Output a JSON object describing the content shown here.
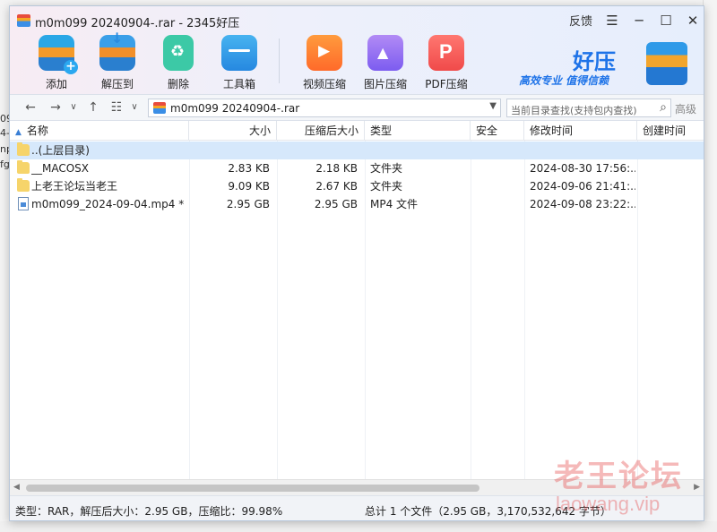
{
  "window": {
    "title": "m0m099 20240904-.rar - 2345好压",
    "feedback_label": "反馈"
  },
  "toolbar": [
    {
      "key": "add",
      "label": "添加",
      "icon": "add-archive-icon"
    },
    {
      "key": "extract",
      "label": "解压到",
      "icon": "extract-icon"
    },
    {
      "key": "delete",
      "label": "删除",
      "icon": "recycle-delete-icon"
    },
    {
      "key": "toolbox",
      "label": "工具箱",
      "icon": "toolbox-icon"
    },
    {
      "key": "video",
      "label": "视频压缩",
      "icon": "video-compress-icon"
    },
    {
      "key": "image",
      "label": "图片压缩",
      "icon": "image-compress-icon"
    },
    {
      "key": "pdf",
      "label": "PDF压缩",
      "icon": "pdf-compress-icon"
    }
  ],
  "brand": {
    "name": "好压",
    "slogan": "高效专业  值得信赖"
  },
  "navbar": {
    "path": "m0m099 20240904-.rar",
    "search_placeholder": "当前目录查找(支持包内查找)",
    "advanced_label": "高级"
  },
  "columns": {
    "name": "名称",
    "size": "大小",
    "packed": "压缩后大小",
    "type": "类型",
    "security": "安全",
    "modified": "修改时间",
    "created": "创建时间"
  },
  "rows": [
    {
      "name": "..(上层目录)",
      "size": "",
      "packed": "",
      "type": "",
      "security": "",
      "modified": "",
      "created": "",
      "icon": "folder-icon",
      "selected": true
    },
    {
      "name": "__MACOSX",
      "size": "2.83 KB",
      "packed": "2.18 KB",
      "type": "文件夹",
      "security": "",
      "modified": "2024-08-30 17:56:...",
      "created": "",
      "icon": "folder-icon",
      "selected": false
    },
    {
      "name": "上老王论坛当老王",
      "size": "9.09 KB",
      "packed": "2.67 KB",
      "type": "文件夹",
      "security": "",
      "modified": "2024-09-06 21:41:...",
      "created": "",
      "icon": "folder-icon",
      "selected": false
    },
    {
      "name": "m0m099_2024-09-04.mp4 *",
      "size": "2.95 GB",
      "packed": "2.95 GB",
      "type": "MP4 文件",
      "security": "",
      "modified": "2024-09-08 23:22:...",
      "created": "",
      "icon": "video-file-icon",
      "selected": false
    }
  ],
  "status": {
    "left": "类型：RAR，解压后大小：2.95 GB，压缩比：99.98%",
    "right": "总计 1 个文件（2.95 GB，3,170,532,642 字节）"
  },
  "watermark": {
    "text_cn": "老王论坛",
    "text_url": "laowang.vip"
  },
  "background": {
    "left_fragments": [
      "09",
      "4-",
      "np",
      "fg"
    ]
  }
}
